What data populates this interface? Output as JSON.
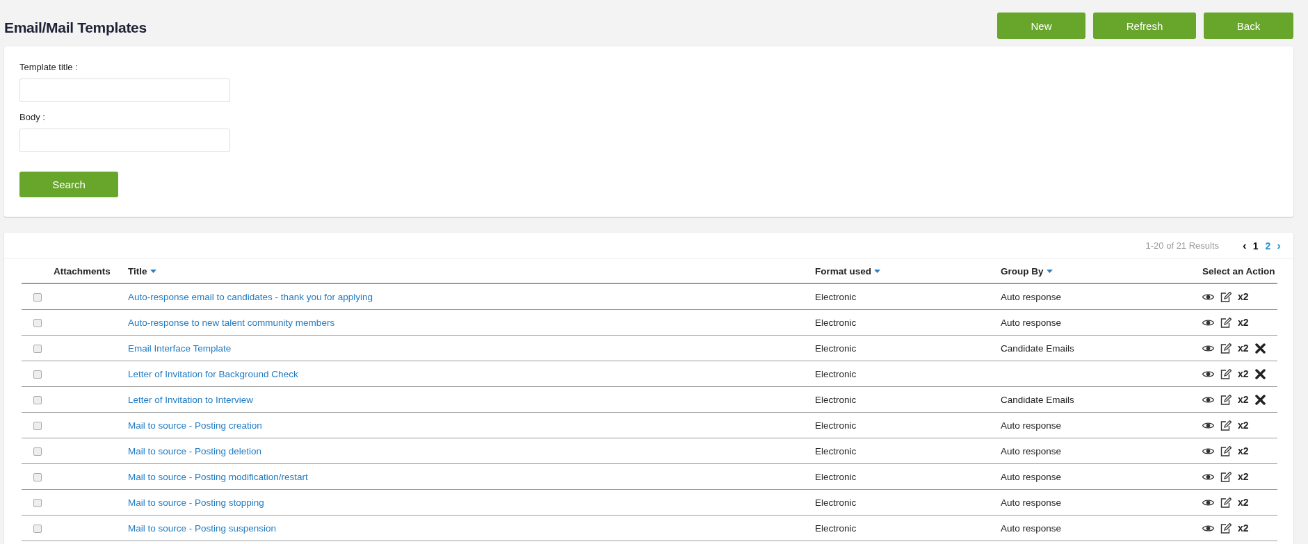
{
  "page_title": "Email/Mail Templates",
  "header_buttons": [
    "New",
    "Refresh",
    "Back"
  ],
  "search_form": {
    "fields": [
      {
        "label": "Template title :"
      },
      {
        "label": "Body :"
      }
    ],
    "search_button": "Search"
  },
  "results": {
    "summary": "1-20 of 21 Results",
    "prev": "‹",
    "pages": [
      {
        "label": "1",
        "selected": true
      },
      {
        "label": "2",
        "selected": false
      }
    ],
    "next": "›"
  },
  "table": {
    "columns": [
      {
        "label": "Attachments",
        "sortable": false
      },
      {
        "label": "Title",
        "sortable": true
      },
      {
        "label": "Format used",
        "sortable": true
      },
      {
        "label": "Group By",
        "sortable": true
      },
      {
        "label": "Select an Action",
        "sortable": false
      }
    ],
    "rows": [
      {
        "checked": false,
        "title": "Auto-response email to candidates - thank you for applying",
        "format": "Electronic",
        "group": "Auto response",
        "copy_label": "x2",
        "deletable": false
      },
      {
        "checked": false,
        "title": "Auto-response to new talent community members",
        "format": "Electronic",
        "group": "Auto response",
        "copy_label": "x2",
        "deletable": false
      },
      {
        "checked": false,
        "title": "Email Interface Template",
        "format": "Electronic",
        "group": "Candidate Emails",
        "copy_label": "x2",
        "deletable": true
      },
      {
        "checked": false,
        "title": "Letter of Invitation for Background Check",
        "format": "Electronic",
        "copy_label": "x2",
        "deletable": true
      },
      {
        "checked": false,
        "title": "Letter of Invitation to Interview",
        "format": "Electronic",
        "group": "Candidate Emails",
        "copy_label": "x2",
        "deletable": true
      },
      {
        "checked": false,
        "title": "Mail to source - Posting creation",
        "format": "Electronic",
        "group": "Auto response",
        "copy_label": "x2",
        "deletable": false
      },
      {
        "checked": false,
        "title": "Mail to source - Posting deletion",
        "format": "Electronic",
        "group": "Auto response",
        "copy_label": "x2",
        "deletable": false
      },
      {
        "checked": false,
        "title": "Mail to source - Posting modification/restart",
        "format": "Electronic",
        "group": "Auto response",
        "copy_label": "x2",
        "deletable": false
      },
      {
        "checked": false,
        "title": "Mail to source - Posting stopping",
        "format": "Electronic",
        "group": "Auto response",
        "copy_label": "x2",
        "deletable": false
      },
      {
        "checked": false,
        "title": "Mail to source - Posting suspension",
        "format": "Electronic",
        "group": "Auto response",
        "copy_label": "x2",
        "deletable": false
      }
    ]
  }
}
